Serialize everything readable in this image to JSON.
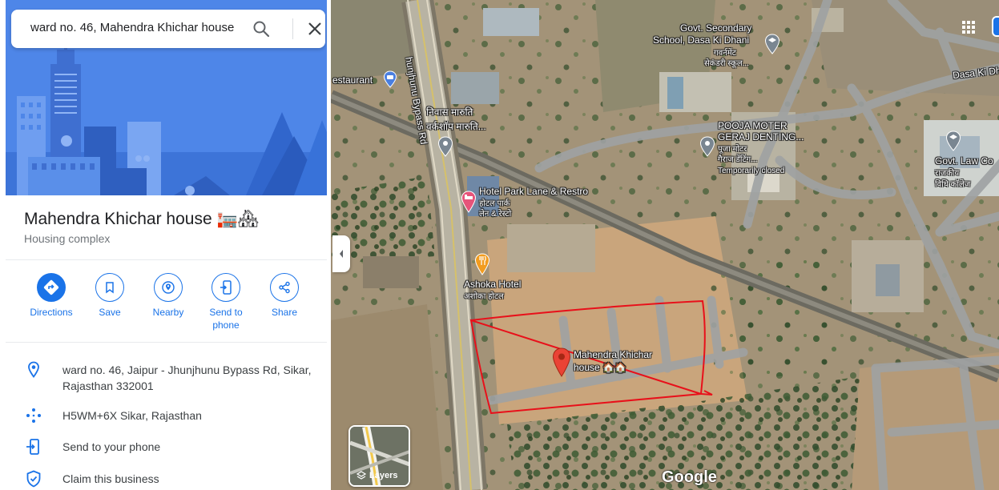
{
  "search": {
    "value": "ward no. 46, Mahendra Khichar house"
  },
  "place": {
    "title": "Mahendra Khichar house 🏣🏘",
    "type": "Housing complex"
  },
  "actions": [
    {
      "label": "Directions",
      "icon": "directions-icon"
    },
    {
      "label": "Save",
      "icon": "bookmark-icon"
    },
    {
      "label": "Nearby",
      "icon": "nearby-icon"
    },
    {
      "label": "Send to\nphone",
      "line1": "Send to",
      "line2": "phone",
      "icon": "send-to-phone-icon"
    },
    {
      "label": "Share",
      "icon": "share-icon"
    }
  ],
  "info": {
    "address_line1": "ward no. 46, Jaipur - Jhunjhunu Bypass Rd, Sikar,",
    "address_line2": "Rajasthan 332001",
    "plus_code": "H5WM+6X Sikar, Rajasthan",
    "send_to_phone": "Send to your phone",
    "claim": "Claim this business"
  },
  "map": {
    "labels": {
      "restaurant": "estaurant",
      "bypass_road": "hunjhunu Bypass Rd",
      "workshop_1": "निवास मारुति",
      "workshop_2": "वर्कशॉप मारुति...",
      "school_1": "Govt. Secondary",
      "school_2": "School, Dasa Ki Dhani",
      "school_3": "गवर्नमेंट",
      "school_4": "सेकंडरी स्कूल...",
      "dasa_road": "Dasa Ki Dh",
      "pooja_1": "POOJA MOTER",
      "pooja_2": "GERAJ DENTING...",
      "pooja_3": "पूजा मोटर",
      "pooja_4": "गैराज डेंटिंग...",
      "pooja_status": "Temporarily closed",
      "law_1": "Govt. Law Co",
      "law_2": "राजकीय",
      "law_3": "विधि कॉलेज",
      "hotel_park_1": "Hotel Park Lane & Restro",
      "hotel_park_2": "होटल पार्क",
      "hotel_park_3": "लेन & रेस्टो",
      "ashoka_1": "Ashoka Hotel",
      "ashoka_2": "अशोका होटल",
      "selected_1": "Mahendra Khichar",
      "selected_2": "house 🏠🏠"
    },
    "layers_label": "Layers",
    "google_logo": "Google"
  },
  "colors": {
    "accent": "#1a73e8",
    "hero_bg": "#4e86e8",
    "selected_pin": "#ea4335",
    "annotation": "#e8101a"
  }
}
